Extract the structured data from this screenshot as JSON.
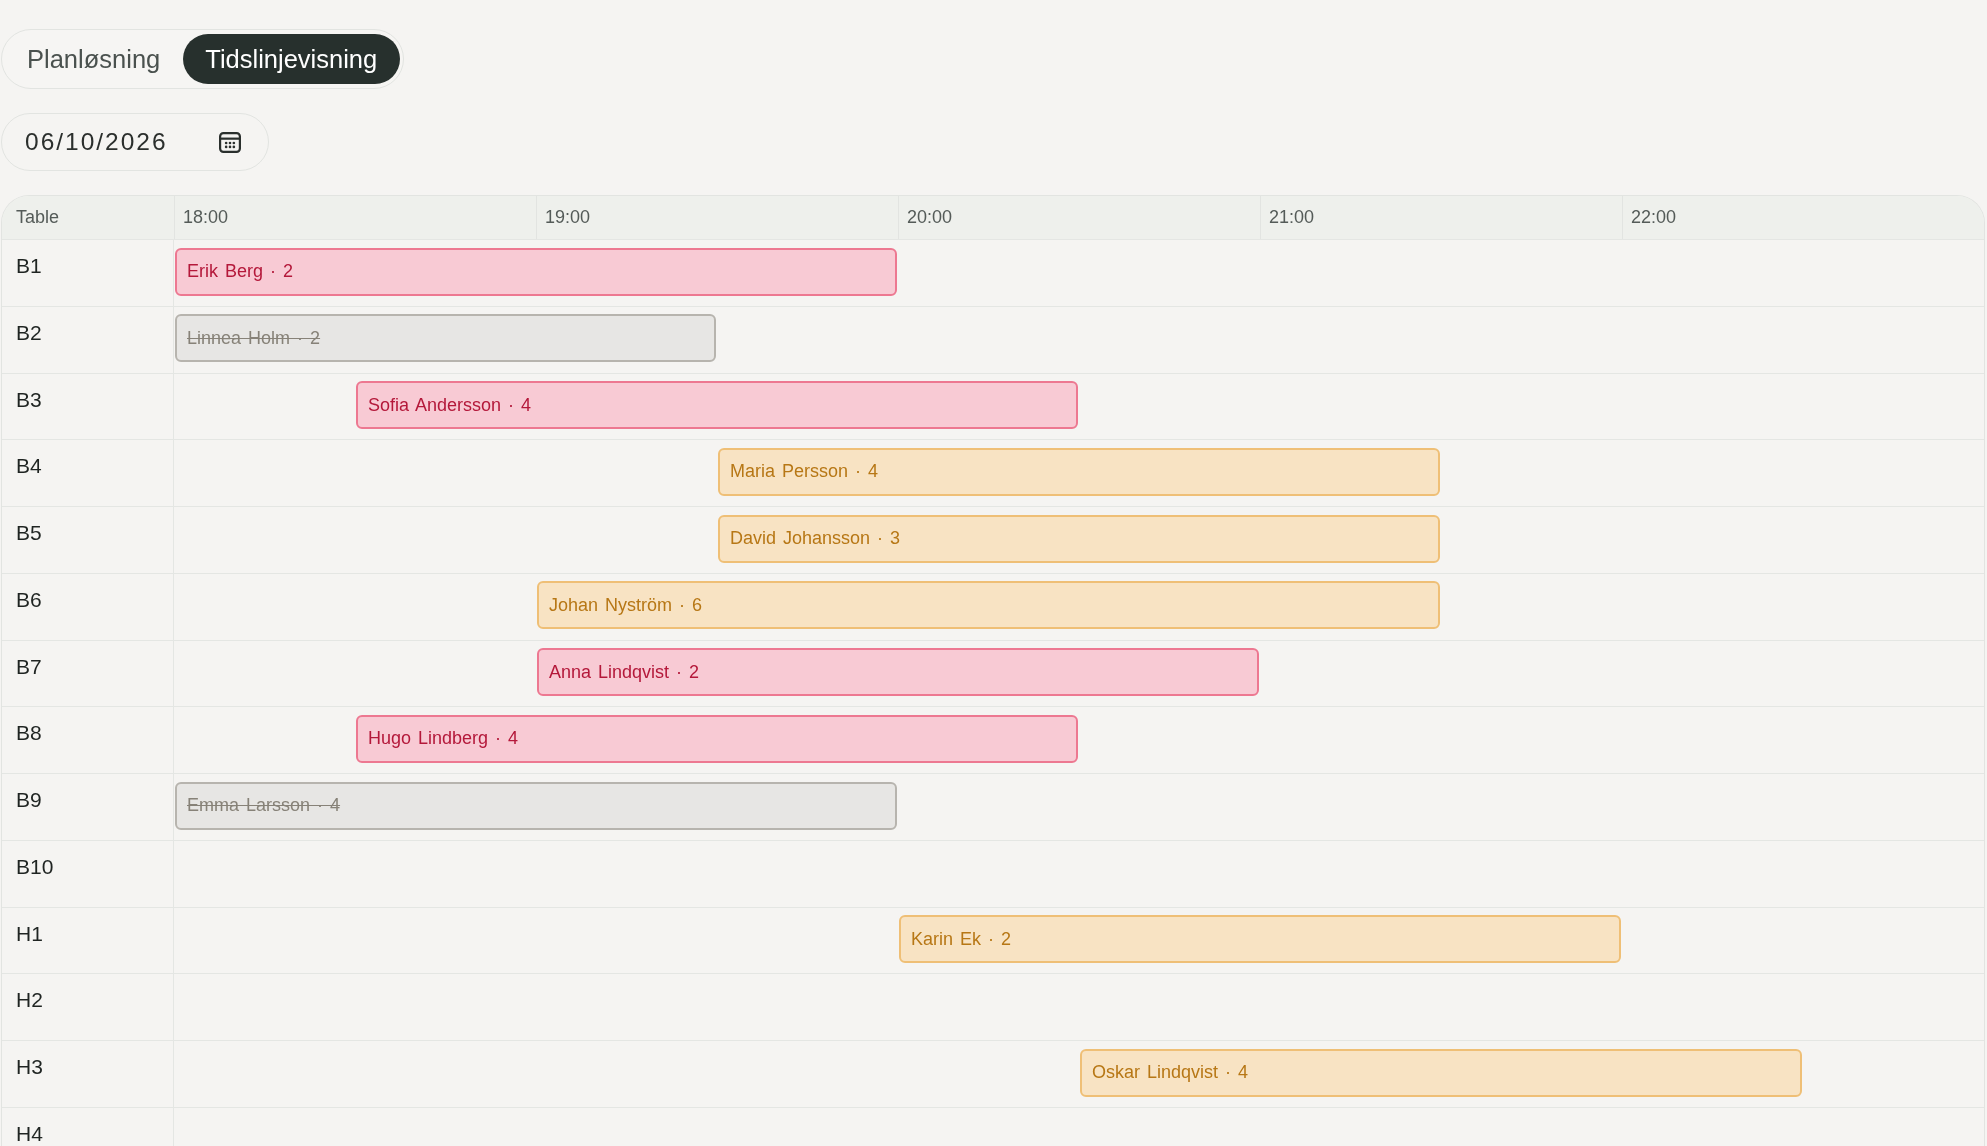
{
  "view_switch": {
    "tabs": [
      {
        "label": "Planløsning",
        "selected": false
      },
      {
        "label": "Tidslinjevisning",
        "selected": true
      }
    ]
  },
  "date_field": {
    "value": "06/10/2026"
  },
  "timeline": {
    "columns": {
      "table": "Table",
      "times": [
        "18:00",
        "19:00",
        "20:00",
        "21:00",
        "22:00"
      ]
    },
    "rows": [
      {
        "table": "B1",
        "bookings": [
          {
            "label": "Erik Berg · 2",
            "start": {
              "level": 0
            },
            "end": {
              "level": 0.4
            },
            "color": "#f8cad4",
            "cancelled": false
          }
        ]
      },
      {
        "table": "B2",
        "bookings": [
          {
            "label": "Linnea Holm · 2",
            "start": {
              "level": 0
            },
            "end": {
              "level": 0.3
            },
            "color": "#e7e6e4",
            "cancelled": true
          }
        ]
      },
      {
        "table": "B3",
        "bookings": [
          {
            "label": "Sofia Andersson · 4",
            "start": {
              "level": 0.1
            },
            "end": {
              "level": 0.5
            },
            "color": "#f8cad4",
            "cancelled": false
          }
        ]
      },
      {
        "table": "B4",
        "bookings": [
          {
            "label": "Maria Persson · 4",
            "start": {
              "level": 0.3
            },
            "end": {
              "level": 0.7
            },
            "color": "#f8e3c3",
            "cancelled": false
          }
        ]
      },
      {
        "table": "B5",
        "bookings": [
          {
            "label": "David Johansson · 3",
            "start": {
              "level": 0.3
            },
            "end": {
              "level": 0.7
            },
            "color": "#f8e3c3",
            "cancelled": false
          }
        ]
      },
      {
        "table": "B6",
        "bookings": [
          {
            "label": "Johan Nyström · 6",
            "start": {
              "level": 0.2
            },
            "end": {
              "level": 0.7
            },
            "color": "#f8e3c3",
            "cancelled": false
          }
        ]
      },
      {
        "table": "B7",
        "bookings": [
          {
            "label": "Anna Lindqvist · 2",
            "start": {
              "level": 0.2
            },
            "end": {
              "level": 0.6
            },
            "color": "#f8cad4",
            "cancelled": false
          }
        ]
      },
      {
        "table": "B8",
        "bookings": [
          {
            "label": "Hugo Lindberg · 4",
            "start": {
              "level": 0.1
            },
            "end": {
              "level": 0.5
            },
            "color": "#f8cad4",
            "cancelled": false
          }
        ]
      },
      {
        "table": "B9",
        "bookings": [
          {
            "label": "Emma Larsson · 4",
            "start": {
              "level": 0
            },
            "end": {
              "level": 0.4
            },
            "color": "#e7e6e4",
            "cancelled": true
          }
        ]
      },
      {
        "table": "B10"
      },
      {
        "table": "H1",
        "bookings": [
          {
            "label": "Karin Ek · 2",
            "start": {
              "level": 0.4
            },
            "end": {
              "level": 0.8
            },
            "color": "#f8e3c3",
            "cancelled": false
          }
        ]
      },
      {
        "table": "H2"
      },
      {
        "table": "H3",
        "bookings": [
          {
            "label": "Oskar Lindqvist · 4",
            "start": {
              "level": 0.5
            },
            "end": {
              "level": 0.9
            },
            "color": "#f8e3c3",
            "cancelled": false
          }
        ]
      },
      {
        "table": "H4"
      }
    ]
  }
}
